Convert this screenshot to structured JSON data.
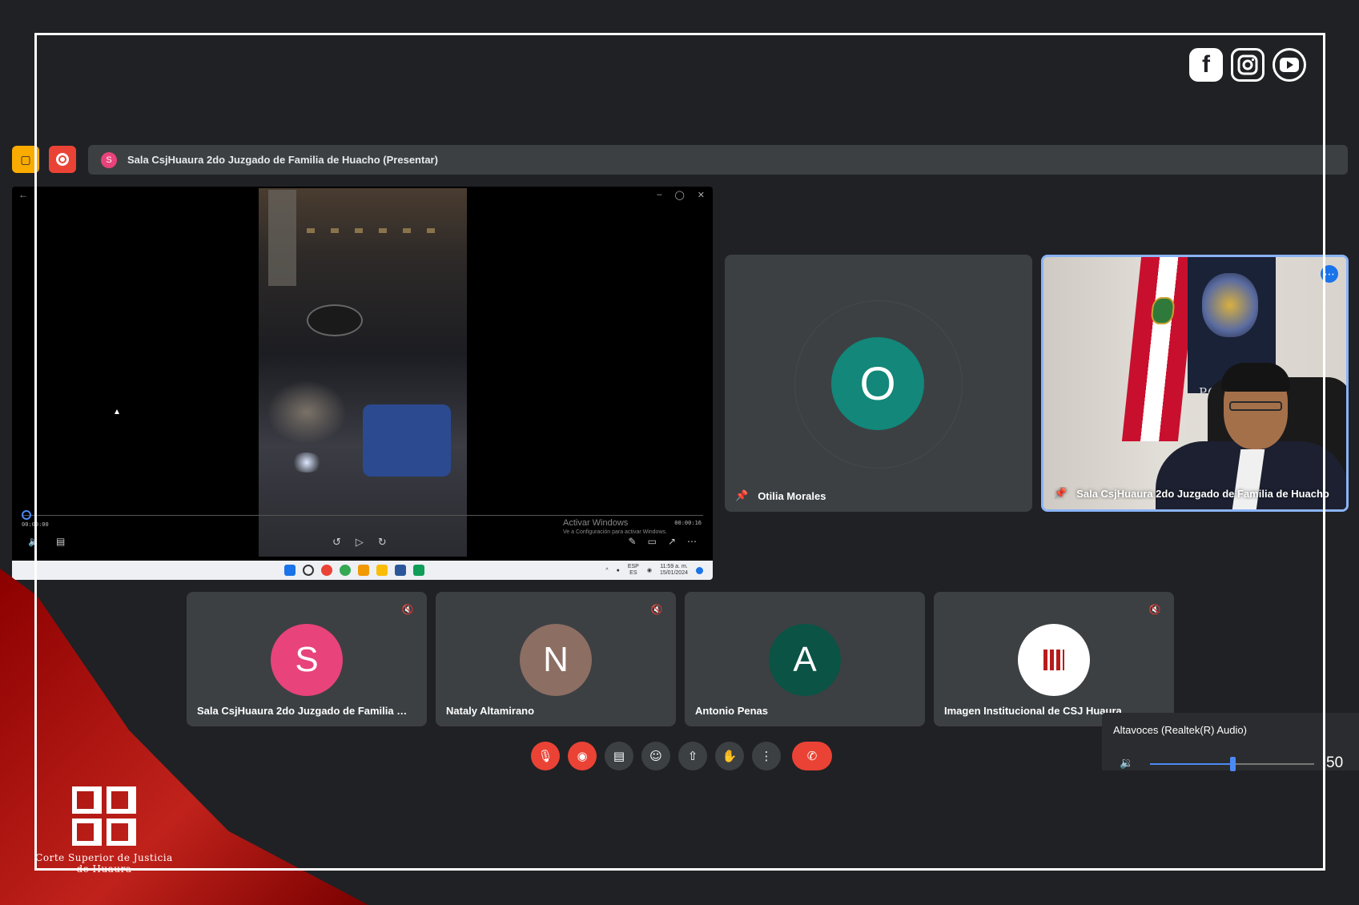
{
  "brand": {
    "social_icons": [
      "facebook-icon",
      "instagram-icon",
      "youtube-icon"
    ],
    "logo_text_line1": "Corte Superior de Justicia",
    "logo_text_line2": "de Huaura",
    "accent_red": "#c0221b"
  },
  "presenter_bar": {
    "avatar_letter": "S",
    "text": "Sala CsjHuaura 2do Juzgado de Familia de Huacho (Presentar)"
  },
  "shared_screen": {
    "time_elapsed": "00:00:00",
    "time_total": "00:00:16",
    "watermark_line1": "Activar Windows",
    "watermark_line2": "Ve a Configuración para activar Windows.",
    "taskbar": {
      "lang_line1": "ESP",
      "lang_line2": "ES",
      "clock_time": "11:59 a. m.",
      "clock_date": "15/01/2024"
    }
  },
  "participants": {
    "large": [
      {
        "name": "Otilia Morales",
        "initial": "O",
        "color": "#12877a"
      },
      {
        "name": "Sala CsjHuaura 2do Juzgado de Familia de Huacho",
        "video": true
      }
    ],
    "small": [
      {
        "name": "Sala CsjHuaura 2do Juzgado de Familia de H...",
        "initial": "S",
        "color": "#e8437a",
        "muted": true
      },
      {
        "name": "Nataly Altamirano",
        "initial": "N",
        "color": "#8d6e63",
        "muted": true
      },
      {
        "name": "Antonio Penas",
        "initial": "A",
        "color": "#0b5345",
        "muted": false
      },
      {
        "name": "Imagen Institucional de CSJ Huaura",
        "logo": true,
        "muted": true
      }
    ]
  },
  "controls": [
    "mic-off-icon",
    "camera-off-icon",
    "captions-icon",
    "emoji-icon",
    "present-icon",
    "raise-hand-icon",
    "more-options-icon",
    "end-call-icon"
  ],
  "volume_popup": {
    "device": "Altavoces (Realtek(R) Audio)",
    "value": "50",
    "level_percent": 50
  },
  "video_overlay": {
    "sign_text": "PODER"
  }
}
